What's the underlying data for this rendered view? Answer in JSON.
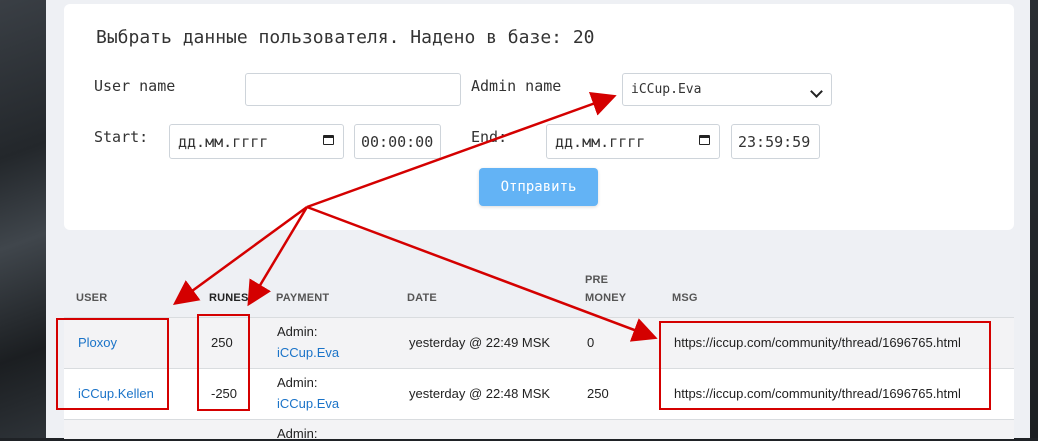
{
  "form": {
    "title": "Выбрать данные пользователя. Надено в базе: 20",
    "user_name_label": "User name",
    "user_name_value": "",
    "admin_name_label": "Admin name",
    "admin_name_selected": "iCCup.Eva",
    "start_label": "Start:",
    "start_date_placeholder": "дд.мм.гггг",
    "start_time": "00:00:00",
    "end_label": "End:",
    "end_date_placeholder": "дд.мм.гггг",
    "end_time": "23:59:59",
    "submit_label": "Отправить"
  },
  "table": {
    "headers": [
      "USER",
      "RUNES",
      "PAYMENT",
      "DATE",
      "PRE",
      "MONEY",
      "MSG"
    ],
    "rows": [
      {
        "user": "Ploxoy",
        "runes": "250",
        "payment_prefix": "Admin:",
        "payment_admin": "iCCup.Eva",
        "date": "yesterday @ 22:49 MSK",
        "pre_money": "0",
        "msg": "https://iccup.com/community/thread/1696765.html"
      },
      {
        "user": "iCCup.Kellen",
        "runes": "-250",
        "payment_prefix": "Admin:",
        "payment_admin": "iCCup.Eva",
        "date": "yesterday @ 22:48 MSK",
        "pre_money": "250",
        "msg": "https://iccup.com/community/thread/1696765.html"
      },
      {
        "payment_prefix": "Admin:"
      }
    ]
  },
  "annotation_colors": {
    "highlight": "#d40000",
    "submit_button": "#63b3f5",
    "link": "#1a73c8"
  }
}
